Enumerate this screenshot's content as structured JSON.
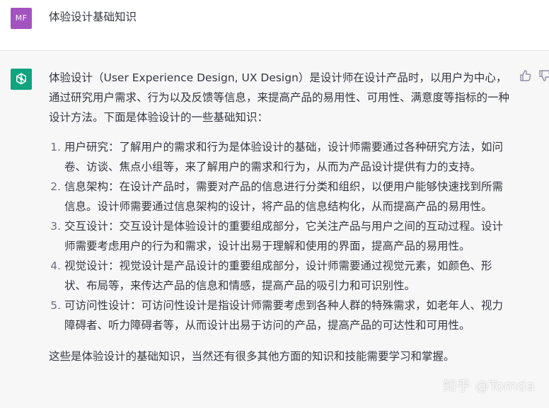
{
  "user": {
    "avatar_initials": "MF",
    "avatar_color": "#a352c0",
    "message": "体验设计基础知识"
  },
  "assistant": {
    "avatar_icon": "openai-logo-icon",
    "avatar_color": "#10a37f",
    "intro": "体验设计（User Experience Design, UX Design）是设计师在设计产品时，以用户为中心，通过研究用户需求、行为以及反馈等信息，来提高产品的易用性、可用性、满意度等指标的一种设计方法。下面是体验设计的一些基础知识：",
    "items": [
      {
        "text": "用户研究：了解用户的需求和行为是体验设计的基础，设计师需要通过各种研究方法，如问卷、访谈、焦点小组等，来了解用户的需求和行为，从而为产品设计提供有力的支持。"
      },
      {
        "text": "信息架构：在设计产品时，需要对产品的信息进行分类和组织，以便用户能够快速找到所需信息。设计师需要通过信息架构的设计，将产品的信息结构化，从而提高产品的易用性。"
      },
      {
        "text": "交互设计：交互设计是体验设计的重要组成部分，它关注产品与用户之间的互动过程。设计师需要考虑用户的行为和需求，设计出易于理解和使用的界面，提高产品的易用性。"
      },
      {
        "text": "视觉设计：视觉设计是产品设计的重要组成部分，设计师需要通过视觉元素，如颜色、形状、布局等，来传达产品的信息和情感，提高产品的吸引力和可识别性。"
      },
      {
        "text": "可访问性设计：可访问性设计是指设计师需要考虑到各种人群的特殊需求，如老年人、视力障碍者、听力障碍者等，从而设计出易于访问的产品，提高产品的可达性和可用性。"
      }
    ],
    "closing": "这些是体验设计的基础知识，当然还有很多其他方面的知识和技能需要学习和掌握。"
  },
  "feedback": {
    "thumbs_up_icon": "thumbs-up-icon",
    "thumbs_down_icon": "thumbs-down-icon"
  },
  "watermark": "知乎 @Tomda"
}
